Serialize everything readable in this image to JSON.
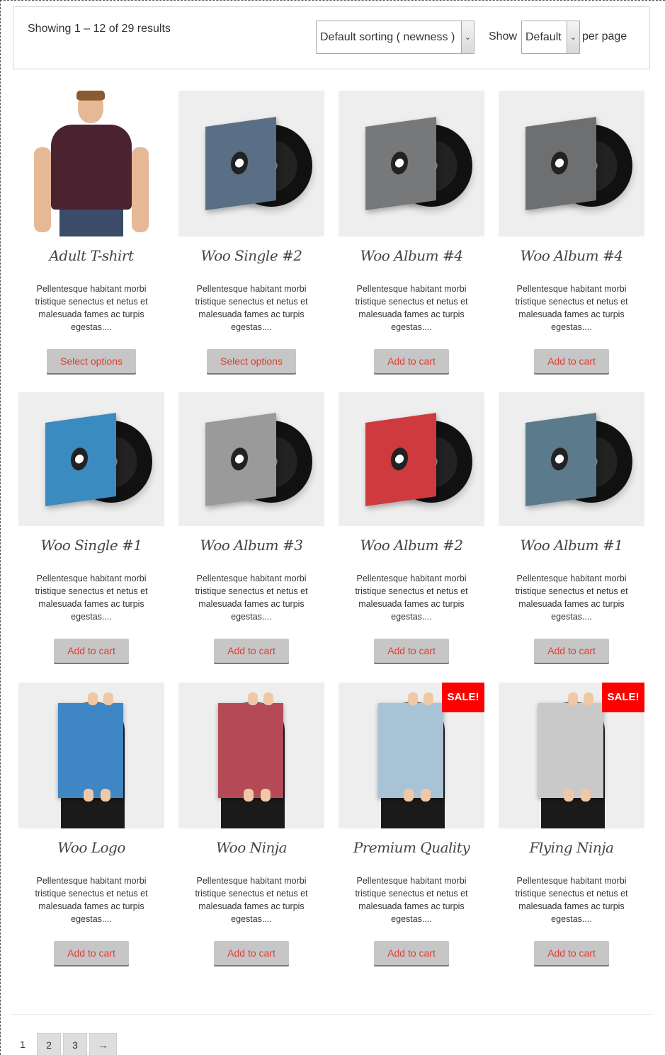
{
  "toolbar": {
    "result_count": "Showing 1 – 12 of 29 results",
    "sort_selected": "Default sorting ( newness )",
    "show_label": "Show",
    "perpage_selected": "Default",
    "perpage_suffix": "per page"
  },
  "products": [
    {
      "title": "Adult T-shirt",
      "desc": "Pellentesque habitant morbi tristique senectus et netus et malesuada fames ac turpis egestas....",
      "button": "Select options",
      "art": "shirt"
    },
    {
      "title": "Woo Single #2",
      "desc": "Pellentesque habitant morbi tristique senectus et netus et malesuada fames ac turpis egestas....",
      "button": "Select options",
      "art": "vinyl",
      "sleeve_color": "#5a6f86"
    },
    {
      "title": "Woo Album #4",
      "desc": "Pellentesque habitant morbi tristique senectus et netus et malesuada fames ac turpis egestas....",
      "button": "Add to cart",
      "art": "vinyl",
      "sleeve_color": "#77787a"
    },
    {
      "title": "Woo Album #4",
      "desc": "Pellentesque habitant morbi tristique senectus et netus et malesuada fames ac turpis egestas....",
      "button": "Add to cart",
      "art": "vinyl",
      "sleeve_color": "#6e6f70"
    },
    {
      "title": "Woo Single #1",
      "desc": "Pellentesque habitant morbi tristique senectus et netus et malesuada fames ac turpis egestas....",
      "button": "Add to cart",
      "art": "vinyl",
      "sleeve_color": "#3a8bbf"
    },
    {
      "title": "Woo Album #3",
      "desc": "Pellentesque habitant morbi tristique senectus et netus et malesuada fames ac turpis egestas....",
      "button": "Add to cart",
      "art": "vinyl",
      "sleeve_color": "#9a9a9a"
    },
    {
      "title": "Woo Album #2",
      "desc": "Pellentesque habitant morbi tristique senectus et netus et malesuada fames ac turpis egestas....",
      "button": "Add to cart",
      "art": "vinyl",
      "sleeve_color": "#cf3a3f"
    },
    {
      "title": "Woo Album #1",
      "desc": "Pellentesque habitant morbi tristique senectus et netus et malesuada fames ac turpis egestas....",
      "button": "Add to cart",
      "art": "vinyl",
      "sleeve_color": "#5b7a8c"
    },
    {
      "title": "Woo Logo",
      "desc": "Pellentesque habitant morbi tristique senectus et netus et malesuada fames ac turpis egestas....",
      "button": "Add to cart",
      "art": "poster",
      "poster_color": "#3f86c4"
    },
    {
      "title": "Woo Ninja",
      "desc": "Pellentesque habitant morbi tristique senectus et netus et malesuada fames ac turpis egestas....",
      "button": "Add to cart",
      "art": "poster",
      "poster_color": "#b54a57"
    },
    {
      "title": "Premium Quality",
      "desc": "Pellentesque habitant morbi tristique senectus et netus et malesuada fames ac turpis egestas....",
      "button": "Add to cart",
      "art": "poster",
      "poster_color": "#a9c3d6",
      "sale": "SALE!"
    },
    {
      "title": "Flying Ninja",
      "desc": "Pellentesque habitant morbi tristique senectus et netus et malesuada fames ac turpis egestas....",
      "button": "Add to cart",
      "art": "poster",
      "poster_color": "#c9c9c9",
      "sale": "SALE!"
    }
  ],
  "pagination": {
    "current": "1",
    "pages": [
      "2",
      "3"
    ],
    "next": "→"
  },
  "colors": {
    "button_text": "#e03c31",
    "button_bg": "#c6c6c6",
    "sale_bg": "#ff0000"
  }
}
